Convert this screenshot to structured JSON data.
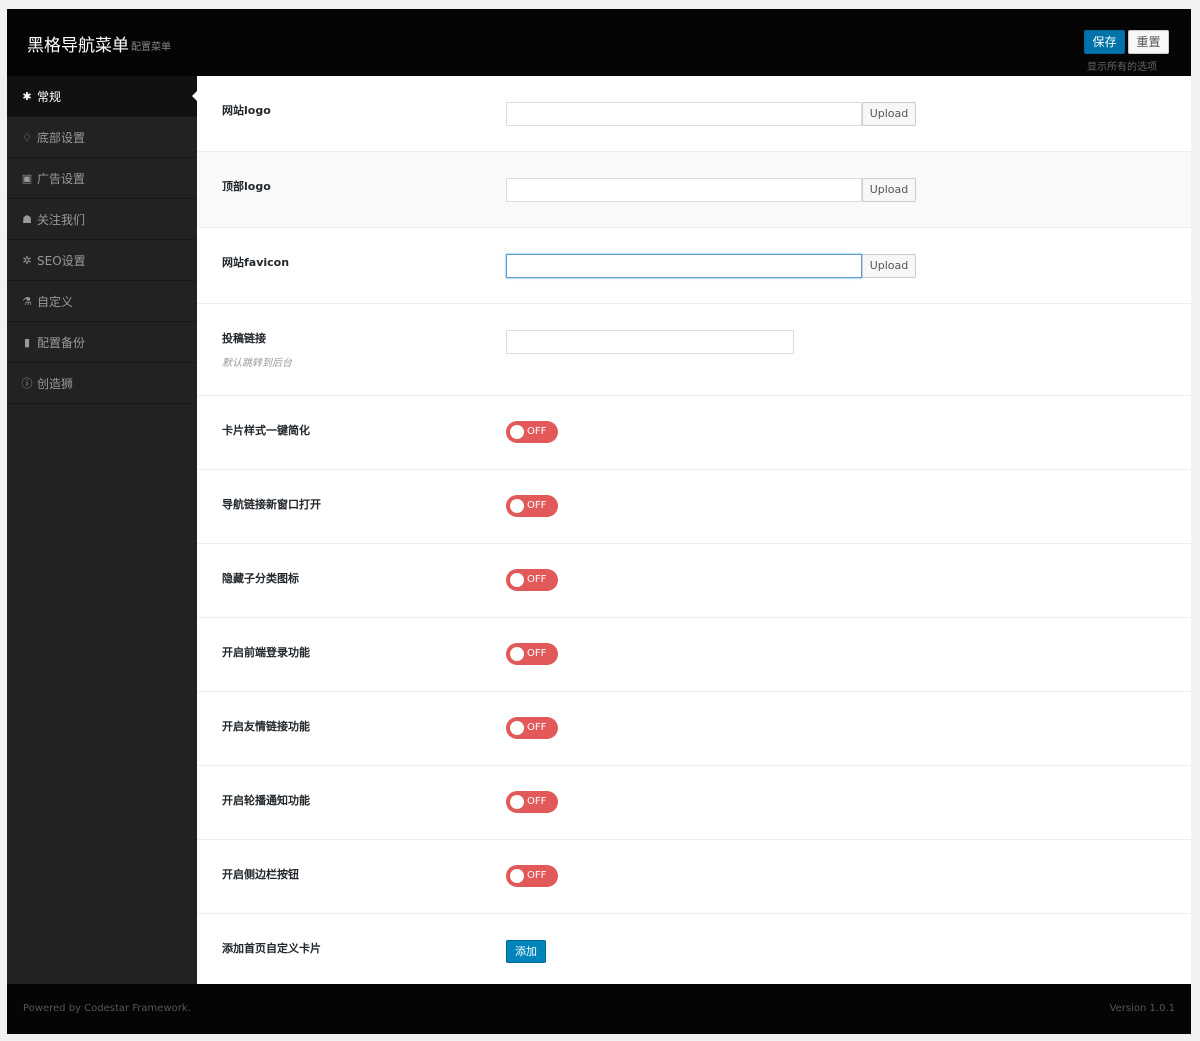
{
  "header": {
    "title": "黑格导航菜单",
    "subtitle": "配置菜单",
    "save_label": "保存",
    "reset_label": "重置",
    "hint": "显示所有的选项"
  },
  "sidebar": {
    "items": [
      {
        "label": "常规",
        "icon": "gear-icon",
        "glyph": "✱"
      },
      {
        "label": "底部设置",
        "icon": "lightbulb-icon",
        "glyph": "♢"
      },
      {
        "label": "广告设置",
        "icon": "money-icon",
        "glyph": "▣"
      },
      {
        "label": "关注我们",
        "icon": "users-icon",
        "glyph": "☗"
      },
      {
        "label": "SEO设置",
        "icon": "bug-icon",
        "glyph": "✲"
      },
      {
        "label": "自定义",
        "icon": "flask-icon",
        "glyph": "⚗"
      },
      {
        "label": "配置备份",
        "icon": "clipboard-icon",
        "glyph": "▮"
      },
      {
        "label": "创造狮",
        "icon": "info-circle-icon",
        "glyph": "ⓘ"
      }
    ]
  },
  "fields": {
    "site_logo": {
      "label": "网站logo",
      "value": "",
      "upload_label": "Upload"
    },
    "top_logo": {
      "label": "顶部logo",
      "value": "",
      "upload_label": "Upload"
    },
    "favicon": {
      "label": "网站favicon",
      "value": "",
      "upload_label": "Upload"
    },
    "submit_link": {
      "label": "投稿链接",
      "desc": "默认跳转到后台",
      "value": ""
    },
    "card_simplify": {
      "label": "卡片样式一键简化",
      "state": "OFF"
    },
    "nav_new_window": {
      "label": "导航链接新窗口打开",
      "state": "OFF"
    },
    "hide_sub_icon": {
      "label": "隐藏子分类图标",
      "state": "OFF"
    },
    "front_login": {
      "label": "开启前端登录功能",
      "state": "OFF"
    },
    "friend_links": {
      "label": "开启友情链接功能",
      "state": "OFF"
    },
    "carousel_notice": {
      "label": "开启轮播通知功能",
      "state": "OFF"
    },
    "sidebar_button": {
      "label": "开启侧边栏按钮",
      "state": "OFF"
    },
    "custom_card": {
      "label": "添加首页自定义卡片",
      "add_label": "添加"
    }
  },
  "footer": {
    "left": "Powered by Codestar Framework.",
    "right": "Version 1.0.1"
  },
  "colors": {
    "accent": "#0073aa",
    "toggle_off": "#e2595a",
    "sidebar_bg": "#222222",
    "header_bg": "#050505"
  }
}
